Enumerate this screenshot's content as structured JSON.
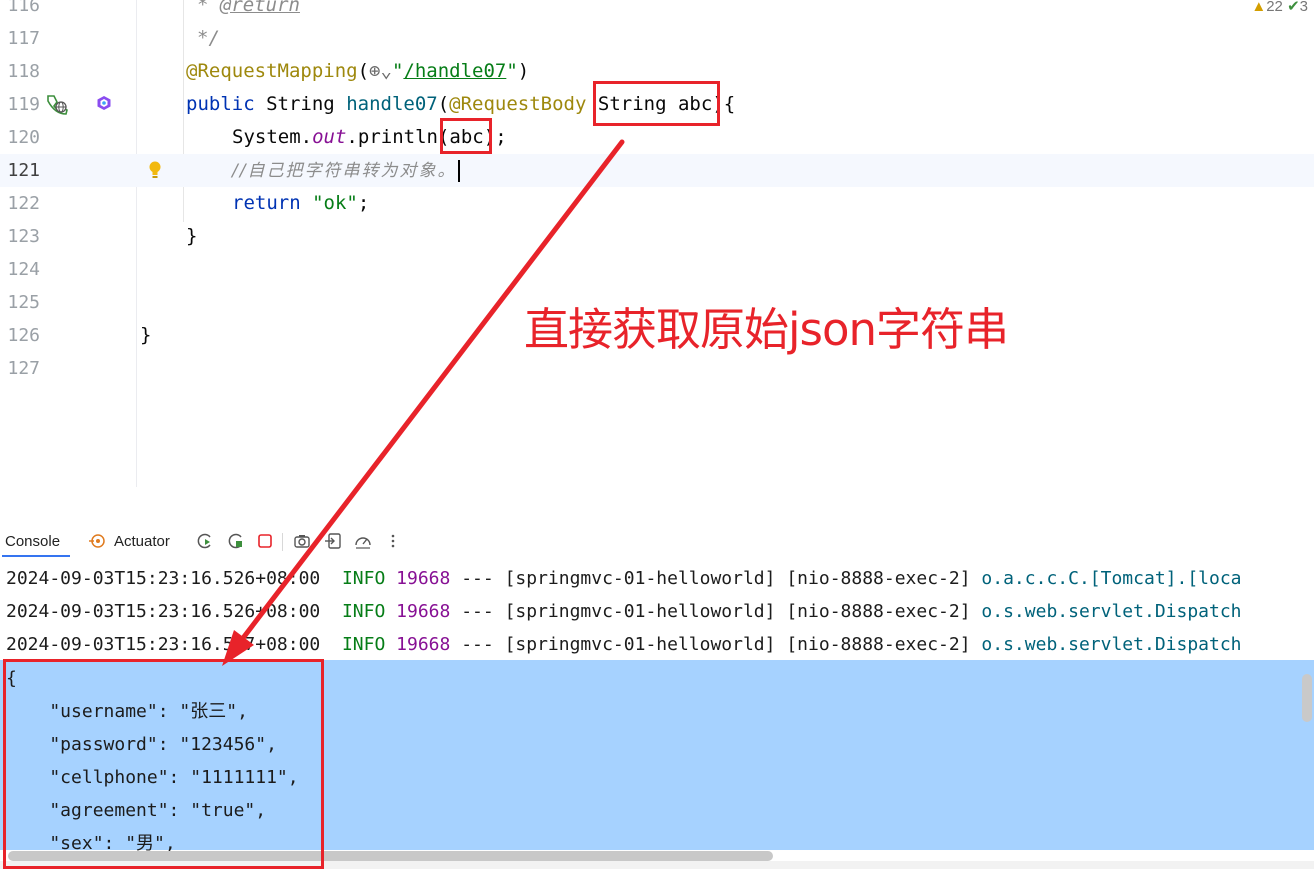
{
  "editor": {
    "inspections": {
      "warnings": "22",
      "checks": "3"
    },
    "lines": [
      {
        "number": "116",
        "code": "* @return"
      },
      {
        "number": "117",
        "code": "*/"
      },
      {
        "number": "118",
        "code": "@RequestMapping(\"/handle07\")"
      },
      {
        "number": "119",
        "code": "public String handle07(@RequestBody String abc){"
      },
      {
        "number": "120",
        "code": "System.out.println(abc);"
      },
      {
        "number": "121",
        "code": "//自己把字符串转为对象。"
      },
      {
        "number": "122",
        "code": "return \"ok\";"
      },
      {
        "number": "123",
        "code": "}"
      },
      {
        "number": "124",
        "code": ""
      },
      {
        "number": "125",
        "code": ""
      },
      {
        "number": "126",
        "code": "}"
      },
      {
        "number": "127",
        "code": ""
      }
    ],
    "tokens": {
      "doc_star": "* ",
      "doc_tag": "@return",
      "doc_end": "*/",
      "annotation_mapping": "@RequestMapping",
      "paren_open": "(",
      "quote": "\"",
      "mapping_path": "/handle07",
      "paren_close": ")",
      "kw_public": "public",
      "type_string": "String",
      "method_name": "handle07",
      "annotation_body": "@RequestBody",
      "param_name": "abc",
      "brace_open": "{",
      "system": "System",
      "out": "out",
      "println": "println",
      "semicolon": ";",
      "comment": "//自己把字符串转为对象。",
      "kw_return": "return",
      "ok_literal": "\"ok\"",
      "brace_close": "}"
    }
  },
  "annotation_text": "直接获取原始json字符串",
  "console": {
    "tabs": {
      "console": "Console",
      "actuator": "Actuator"
    },
    "log_lines": [
      {
        "timestamp": "2024-09-03T15:23:16.526+08:00",
        "level": "INFO",
        "pid": "19668",
        "sep": "---",
        "app": "[springmvc-01-helloworld]",
        "thread": "[nio-8888-exec-2]",
        "logger": "o.a.c.c.C.[Tomcat].[loca"
      },
      {
        "timestamp": "2024-09-03T15:23:16.526+08:00",
        "level": "INFO",
        "pid": "19668",
        "sep": "---",
        "app": "[springmvc-01-helloworld]",
        "thread": "[nio-8888-exec-2]",
        "logger": "o.s.web.servlet.Dispatch"
      },
      {
        "timestamp": "2024-09-03T15:23:16.527+08:00",
        "level": "INFO",
        "pid": "19668",
        "sep": "---",
        "app": "[springmvc-01-helloworld]",
        "thread": "[nio-8888-exec-2]",
        "logger": "o.s.web.servlet.Dispatch"
      }
    ],
    "json_output": [
      "{",
      "    \"username\": \"张三\",",
      "    \"password\": \"123456\",",
      "    \"cellphone\": \"1111111\",",
      "    \"agreement\": \"true\",",
      "    \"sex\": \"男\","
    ]
  },
  "colors": {
    "highlight_red": "#e8232a",
    "selection_blue": "#a6d2ff",
    "keyword": "#0033b3",
    "annotation": "#9e880d",
    "string": "#067d17"
  },
  "icons": {
    "gutter": [
      "request-mapping-globe-icon",
      "spring-bean-icon",
      "intention-bulb-icon"
    ],
    "toolbar": [
      "actuator-icon",
      "rerun-icon",
      "restart-icon",
      "stop-icon",
      "screenshot-icon",
      "export-icon",
      "dashboard-icon",
      "more-icon"
    ]
  }
}
